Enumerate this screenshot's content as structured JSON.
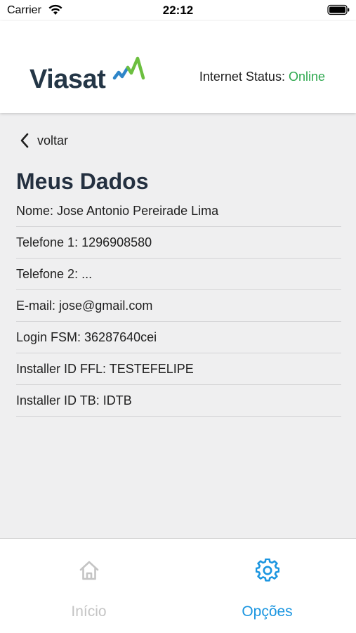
{
  "status_bar": {
    "carrier": "Carrier",
    "time": "22:12"
  },
  "header": {
    "logo_text": "Viasat",
    "internet_status_label": "Internet Status:",
    "internet_status_value": "Online"
  },
  "back": {
    "label": "voltar"
  },
  "page_title": "Meus Dados",
  "rows": [
    "Nome: Jose Antonio Pereirade Lima",
    "Telefone 1: 1296908580",
    "Telefone 2: ...",
    "E-mail: jose@gmail.com",
    "Login FSM: 36287640cei",
    "Installer ID FFL: TESTEFELIPE",
    "Installer ID TB: IDTB"
  ],
  "tabbar": {
    "tabs": [
      {
        "label": "Início",
        "icon": "home-icon",
        "active": false
      },
      {
        "label": "Opções",
        "icon": "gear-icon",
        "active": true
      }
    ]
  },
  "colors": {
    "online": "#2ea84f",
    "active_tab": "#1a95e0",
    "inactive_tab": "#c4c4c4",
    "title": "#243040",
    "logo_text": "#243646",
    "logo_mark_blue": "#2f86c9",
    "logo_mark_green": "#6cbf3f"
  }
}
